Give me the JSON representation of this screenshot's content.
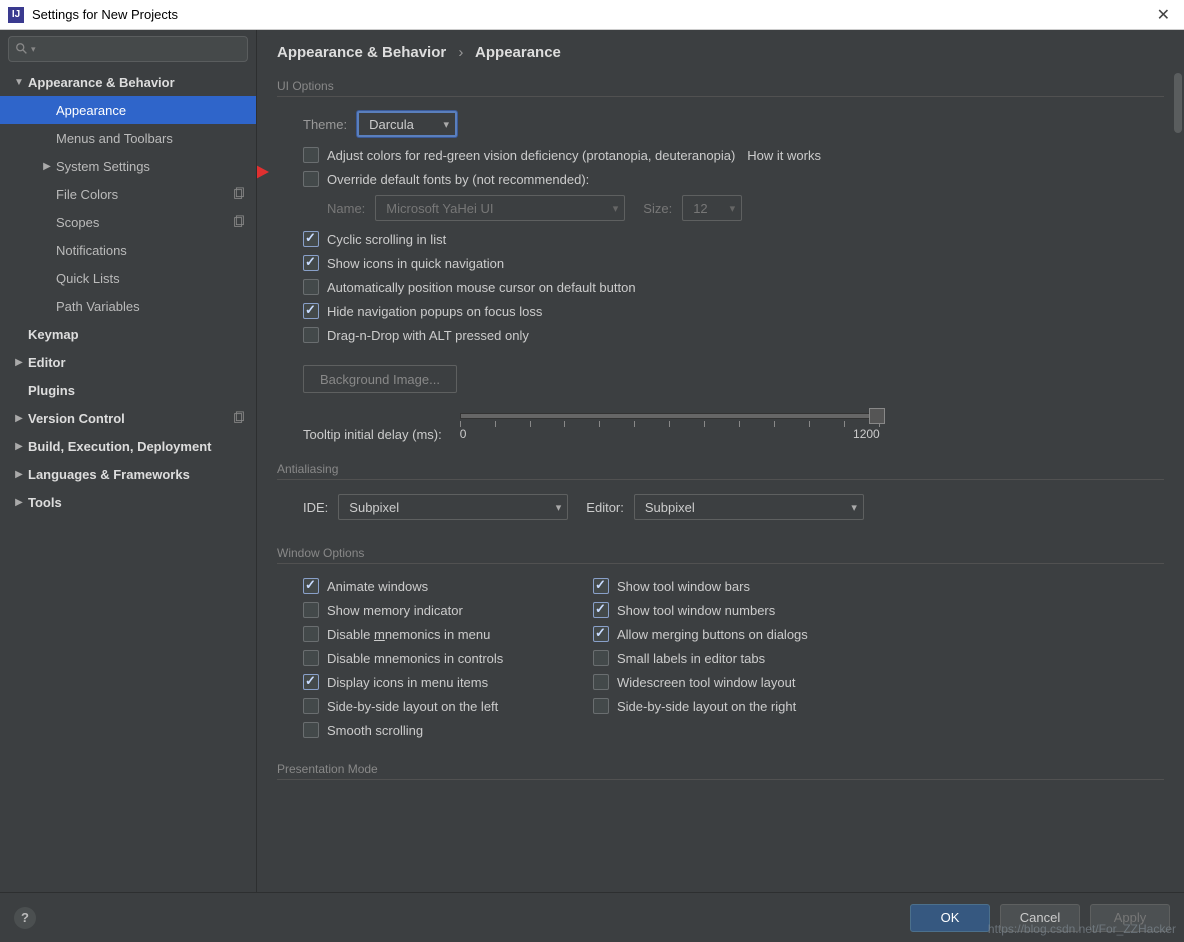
{
  "window": {
    "title": "Settings for New Projects"
  },
  "sidebar": {
    "search_placeholder": "",
    "items": [
      {
        "label": "Appearance & Behavior",
        "level": 0,
        "bold": true,
        "arrow": "▼"
      },
      {
        "label": "Appearance",
        "level": 1,
        "selected": true
      },
      {
        "label": "Menus and Toolbars",
        "level": 1
      },
      {
        "label": "System Settings",
        "level": 1,
        "arrow": "▶"
      },
      {
        "label": "File Colors",
        "level": 1,
        "copy": true
      },
      {
        "label": "Scopes",
        "level": 1,
        "copy": true
      },
      {
        "label": "Notifications",
        "level": 1
      },
      {
        "label": "Quick Lists",
        "level": 1
      },
      {
        "label": "Path Variables",
        "level": 1
      },
      {
        "label": "Keymap",
        "level": 0,
        "bold": true
      },
      {
        "label": "Editor",
        "level": 0,
        "bold": true,
        "arrow": "▶"
      },
      {
        "label": "Plugins",
        "level": 0,
        "bold": true
      },
      {
        "label": "Version Control",
        "level": 0,
        "bold": true,
        "arrow": "▶",
        "copy": true
      },
      {
        "label": "Build, Execution, Deployment",
        "level": 0,
        "bold": true,
        "arrow": "▶"
      },
      {
        "label": "Languages & Frameworks",
        "level": 0,
        "bold": true,
        "arrow": "▶"
      },
      {
        "label": "Tools",
        "level": 0,
        "bold": true,
        "arrow": "▶"
      }
    ]
  },
  "breadcrumb": {
    "a": "Appearance & Behavior",
    "b": "Appearance"
  },
  "ui_options": {
    "title": "UI Options",
    "theme_label": "Theme:",
    "theme_value": "Darcula",
    "adjust_colors": "Adjust colors for red-green vision deficiency (protanopia, deuteranopia)",
    "how_it_works": "How it works",
    "override_fonts": "Override default fonts by (not recommended):",
    "font_name_label": "Name:",
    "font_name_value": "Microsoft YaHei UI",
    "font_size_label": "Size:",
    "font_size_value": "12",
    "cyclic": "Cyclic scrolling in list",
    "show_icons": "Show icons in quick navigation",
    "auto_cursor": "Automatically position mouse cursor on default button",
    "hide_nav": "Hide navigation popups on focus loss",
    "drag_alt": "Drag-n-Drop with ALT pressed only",
    "bg_image": "Background Image...",
    "tooltip_label": "Tooltip initial delay (ms):",
    "tooltip_min": "0",
    "tooltip_max": "1200"
  },
  "antialiasing": {
    "title": "Antialiasing",
    "ide_label": "IDE:",
    "ide_value": "Subpixel",
    "editor_label": "Editor:",
    "editor_value": "Subpixel"
  },
  "window_options": {
    "title": "Window Options",
    "left": [
      {
        "label": "Animate windows",
        "checked": true
      },
      {
        "label": "Show memory indicator",
        "checked": false
      },
      {
        "label": "Disable mnemonics in menu",
        "checked": false,
        "underline": "m"
      },
      {
        "label": "Disable mnemonics in controls",
        "checked": false
      },
      {
        "label": "Display icons in menu items",
        "checked": true
      },
      {
        "label": "Side-by-side layout on the left",
        "checked": false
      },
      {
        "label": "Smooth scrolling",
        "checked": false
      }
    ],
    "right": [
      {
        "label": "Show tool window bars",
        "checked": true
      },
      {
        "label": "Show tool window numbers",
        "checked": true
      },
      {
        "label": "Allow merging buttons on dialogs",
        "checked": true
      },
      {
        "label": "Small labels in editor tabs",
        "checked": false
      },
      {
        "label": "Widescreen tool window layout",
        "checked": false
      },
      {
        "label": "Side-by-side layout on the right",
        "checked": false
      }
    ]
  },
  "presentation": {
    "title": "Presentation Mode"
  },
  "footer": {
    "ok": "OK",
    "cancel": "Cancel",
    "apply": "Apply"
  },
  "watermark": "https://blog.csdn.net/For_ZZHacker"
}
